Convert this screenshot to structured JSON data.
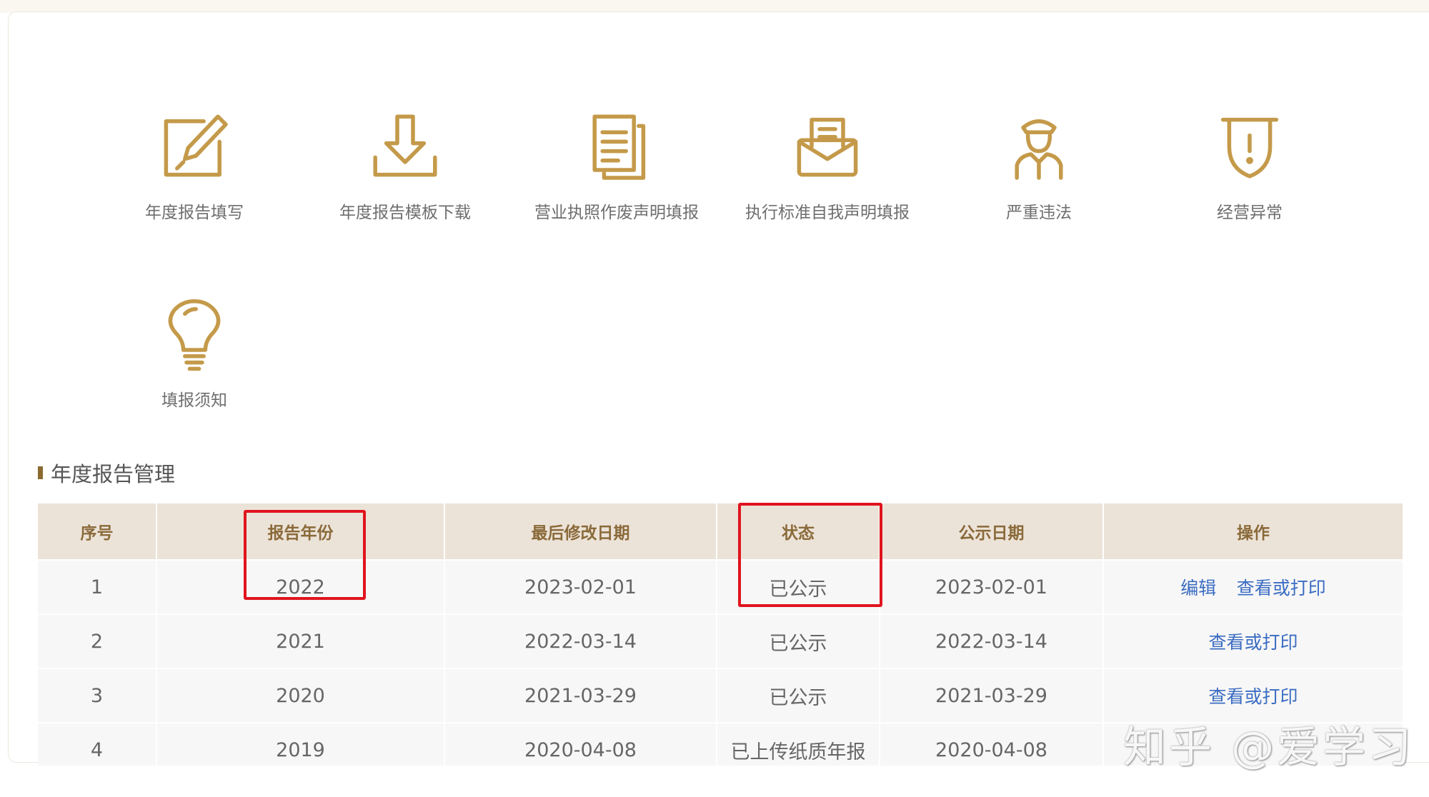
{
  "colors": {
    "icon_gold": "#c49a4a",
    "header_bg": "#ece3d8",
    "header_text": "#8a6a3a",
    "link": "#3b6cc2",
    "highlight": "#e0141e"
  },
  "tiles": [
    {
      "label": "年度报告填写",
      "icon": "edit-icon"
    },
    {
      "label": "年度报告模板下载",
      "icon": "download-icon"
    },
    {
      "label": "营业执照作废声明填报",
      "icon": "document-icon"
    },
    {
      "label": "执行标准自我声明填报",
      "icon": "envelope-icon"
    },
    {
      "label": "严重违法",
      "icon": "officer-icon"
    },
    {
      "label": "经营异常",
      "icon": "shield-icon"
    },
    {
      "label": "填报须知",
      "icon": "lightbulb-icon"
    }
  ],
  "section": {
    "title": "年度报告管理"
  },
  "table": {
    "headers": [
      "序号",
      "报告年份",
      "最后修改日期",
      "状态",
      "公示日期",
      "操作"
    ],
    "rows": [
      {
        "no": "1",
        "year": "2022",
        "modified": "2023-02-01",
        "status": "已公示",
        "publish": "2023-02-01",
        "actions": [
          "编辑",
          "查看或打印"
        ]
      },
      {
        "no": "2",
        "year": "2021",
        "modified": "2022-03-14",
        "status": "已公示",
        "publish": "2022-03-14",
        "actions": [
          "查看或打印"
        ]
      },
      {
        "no": "3",
        "year": "2020",
        "modified": "2021-03-29",
        "status": "已公示",
        "publish": "2021-03-29",
        "actions": [
          "查看或打印"
        ]
      },
      {
        "no": "4",
        "year": "2019",
        "modified": "2020-04-08",
        "status": "已上传纸质年报",
        "publish": "2020-04-08",
        "actions": []
      }
    ]
  },
  "watermark": "知乎 @爱学习"
}
